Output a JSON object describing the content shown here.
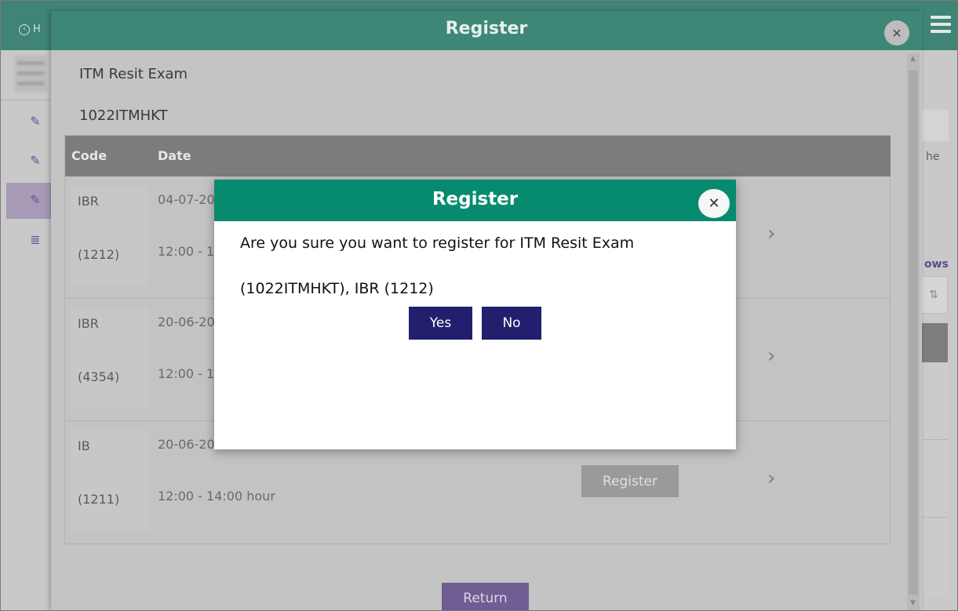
{
  "background": {
    "back_link": "H",
    "right_text_1": "he",
    "right_text_2": "ows"
  },
  "register_modal": {
    "title": "Register",
    "exam_name": "ITM Resit Exam",
    "exam_code": "1022ITMHKT",
    "table": {
      "headers": {
        "code": "Code",
        "date": "Date"
      },
      "rows": [
        {
          "code": "IBR",
          "number": "(1212)",
          "date_range": "04-07-20",
          "time": "12:00 - 1",
          "action": ""
        },
        {
          "code": "IBR",
          "number": "(4354)",
          "date_range": "20-06-20",
          "time": "12:00 - 1",
          "action": ""
        },
        {
          "code": "IB",
          "number": "(1211)",
          "date_range": "20-06-2017 until 20-06-2017",
          "time": "12:00 - 14:00 hour",
          "action": "Register"
        }
      ]
    },
    "return_label": "Return"
  },
  "confirm_dialog": {
    "title": "Register",
    "message_line1": "Are you sure you want to register for ITM Resit Exam",
    "message_line2": "(1022ITMHKT), IBR (1212)",
    "yes_label": "Yes",
    "no_label": "No"
  },
  "icons": {
    "close": "close-icon",
    "chevron": "chevron-right-icon",
    "back": "back-circle-icon",
    "menu": "hamburger-menu-icon",
    "sidebar": "edit-icon",
    "list": "list-icon",
    "sort": "sort-icon"
  },
  "colors": {
    "header_green": "#068b6f",
    "button_navy": "#22206e",
    "accent_purple": "#6f5d93"
  }
}
